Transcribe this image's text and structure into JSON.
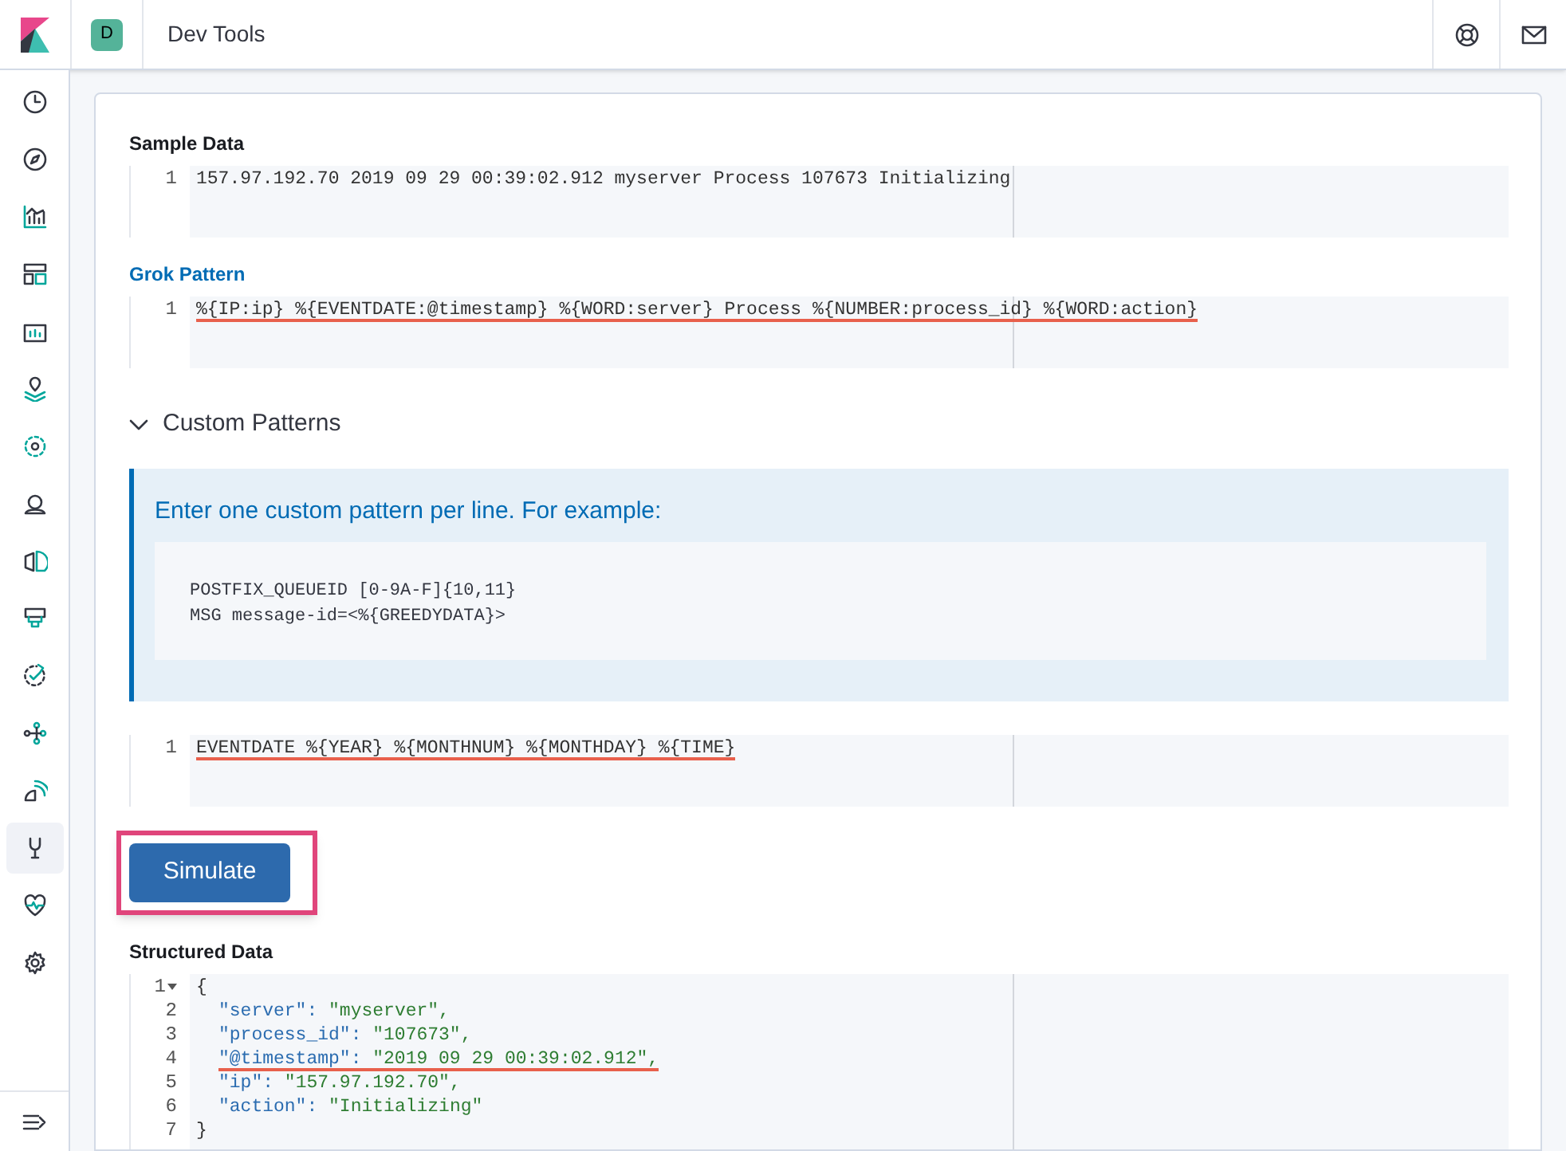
{
  "header": {
    "avatar": "D",
    "title": "Dev Tools"
  },
  "sidebar": {
    "items": [
      {
        "selected": false
      },
      {
        "selected": false
      },
      {
        "selected": false
      },
      {
        "selected": false
      },
      {
        "selected": false
      },
      {
        "selected": false
      },
      {
        "selected": false
      },
      {
        "selected": false
      },
      {
        "selected": false
      },
      {
        "selected": false
      },
      {
        "selected": false
      },
      {
        "selected": false
      },
      {
        "selected": false
      },
      {
        "selected": true
      },
      {
        "selected": false
      },
      {
        "selected": false
      }
    ]
  },
  "sample_data": {
    "label": "Sample Data",
    "lines": [
      {
        "number": "1",
        "text": "157.97.192.70 2019 09 29 00:39:02.912 myserver Process 107673 Initializing"
      }
    ]
  },
  "grok_pattern": {
    "label": "Grok Pattern",
    "lines": [
      {
        "number": "1",
        "text": "%{IP:ip} %{EVENTDATE:@timestamp} %{WORD:server} Process %{NUMBER:process_id} %{WORD:action}",
        "underlined": true
      }
    ]
  },
  "custom_patterns": {
    "title": "Custom Patterns",
    "expanded": true,
    "callout_title": "Enter one custom pattern per line. For example:",
    "example_lines": [
      "POSTFIX_QUEUEID [0-9A-F]{10,11}",
      "MSG message-id=<%{GREEDYDATA}>"
    ],
    "lines": [
      {
        "number": "1",
        "text": "EVENTDATE %{YEAR} %{MONTHNUM} %{MONTHDAY} %{TIME}",
        "underlined": true
      }
    ]
  },
  "simulate_button": {
    "label": "Simulate",
    "highlighted": true
  },
  "structured_data": {
    "label": "Structured Data",
    "lines": [
      {
        "number": "1",
        "kind": "brace",
        "text": "{",
        "foldable": true
      },
      {
        "number": "2",
        "kind": "pair",
        "key": "\"server\":",
        "value": "\"myserver\","
      },
      {
        "number": "3",
        "kind": "pair",
        "key": "\"process_id\":",
        "value": "\"107673\","
      },
      {
        "number": "4",
        "kind": "pair",
        "key": "\"@timestamp\":",
        "value": "\"2019 09 29 00:39:02.912\",",
        "underlined": true
      },
      {
        "number": "5",
        "kind": "pair",
        "key": "\"ip\":",
        "value": "\"157.97.192.70\","
      },
      {
        "number": "6",
        "kind": "pair",
        "key": "\"action\":",
        "value": "\"Initializing\""
      },
      {
        "number": "7",
        "kind": "brace",
        "text": "}"
      }
    ]
  }
}
